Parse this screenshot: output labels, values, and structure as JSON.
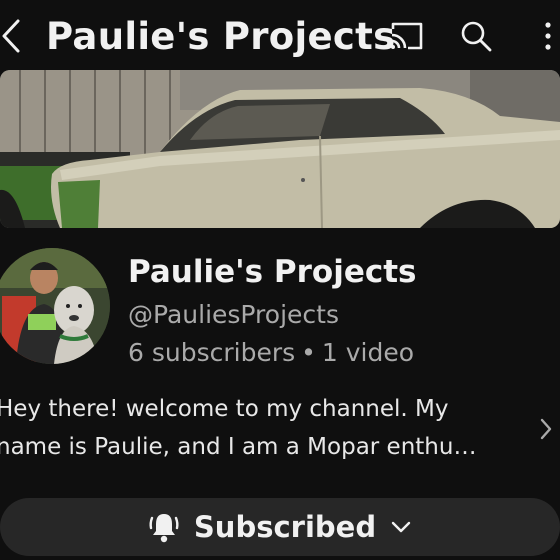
{
  "header": {
    "title": "Paulie's Projects"
  },
  "channel": {
    "name": "Paulie's Projects",
    "handle": "@PauliesProjects",
    "subscribers": "6 subscribers",
    "separator": "•",
    "videos": "1 video"
  },
  "description": {
    "line1": "Hey there! welcome to my channel. My",
    "line2": "name is Paulie, and I am a Mopar enthu…"
  },
  "subscribe_button": {
    "label": "Subscribed"
  },
  "icons": {
    "back": "chevron-left-icon",
    "cast": "cast-icon",
    "search": "search-icon",
    "more": "more-vertical-icon",
    "bell": "bell-icon",
    "dropdown": "chevron-down-icon",
    "expand": "chevron-right-icon"
  },
  "colors": {
    "background": "#0f0f0f",
    "text_primary": "#f1f1f1",
    "text_secondary": "#aaaaaa",
    "button_bg": "#272727"
  }
}
